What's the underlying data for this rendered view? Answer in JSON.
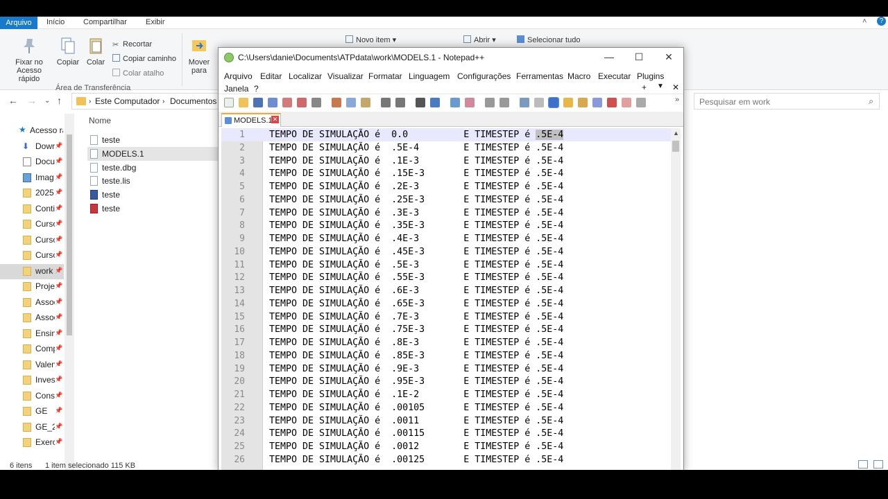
{
  "explorer": {
    "tabs": [
      "Arquivo",
      "Início",
      "Compartilhar",
      "Exibir"
    ],
    "ribbon": {
      "pin_label_1": "Fixar no",
      "pin_label_2": "Acesso rápido",
      "copy": "Copiar",
      "paste": "Colar",
      "cut": "Recortar",
      "copy_path": "Copiar caminho",
      "paste_shortcut": "Colar atalho",
      "move_1": "Mover",
      "move_2": "para",
      "new_item": "Novo item",
      "open": "Abrir",
      "select_all": "Selecionar tudo",
      "clipboard_group": "Área de Transferência"
    },
    "address": {
      "crumb1": "Este Computador",
      "crumb2": "Documentos",
      "search_placeholder": "Pesquisar em work"
    },
    "nav_items": [
      {
        "label": "Acesso rá"
      },
      {
        "label": "Dowr"
      },
      {
        "label": "Docu"
      },
      {
        "label": "Imag"
      },
      {
        "label": "2025"
      },
      {
        "label": "Conti"
      },
      {
        "label": "Curso"
      },
      {
        "label": "Curso"
      },
      {
        "label": "Curso"
      },
      {
        "label": "work"
      },
      {
        "label": "Proje"
      },
      {
        "label": "Assoc"
      },
      {
        "label": "Assoc"
      },
      {
        "label": "Ensin"
      },
      {
        "label": "Comp"
      },
      {
        "label": "Valen"
      },
      {
        "label": "Inves"
      },
      {
        "label": "Cons"
      },
      {
        "label": "GE"
      },
      {
        "label": "GE_2("
      },
      {
        "label": "Exerc"
      }
    ],
    "list_header": "Nome",
    "files": [
      "teste",
      "MODELS.1",
      "teste.dbg",
      "teste.lis",
      "teste",
      "teste"
    ],
    "status": {
      "count": "6 itens",
      "selected": "1 item selecionado  115 KB"
    }
  },
  "npp": {
    "title": "C:\\Users\\danie\\Documents\\ATPdata\\work\\MODELS.1 - Notepad++",
    "menu": [
      "Arquivo",
      "Editar",
      "Localizar",
      "Visualizar",
      "Formatar",
      "Linguagem",
      "Configurações",
      "Ferramentas",
      "Macro",
      "Executar",
      "Plugins",
      "Janela",
      "?"
    ],
    "menu_extra": [
      "+",
      "▼",
      "✕"
    ],
    "tab_label": "MODELS.1",
    "lines": [
      {
        "n": "1",
        "time": "0.0",
        "step": ".5E-4"
      },
      {
        "n": "2",
        "time": ".5E-4",
        "step": ".5E-4"
      },
      {
        "n": "3",
        "time": ".1E-3",
        "step": ".5E-4"
      },
      {
        "n": "4",
        "time": ".15E-3",
        "step": ".5E-4"
      },
      {
        "n": "5",
        "time": ".2E-3",
        "step": ".5E-4"
      },
      {
        "n": "6",
        "time": ".25E-3",
        "step": ".5E-4"
      },
      {
        "n": "7",
        "time": ".3E-3",
        "step": ".5E-4"
      },
      {
        "n": "8",
        "time": ".35E-3",
        "step": ".5E-4"
      },
      {
        "n": "9",
        "time": ".4E-3",
        "step": ".5E-4"
      },
      {
        "n": "10",
        "time": ".45E-3",
        "step": ".5E-4"
      },
      {
        "n": "11",
        "time": ".5E-3",
        "step": ".5E-4"
      },
      {
        "n": "12",
        "time": ".55E-3",
        "step": ".5E-4"
      },
      {
        "n": "13",
        "time": ".6E-3",
        "step": ".5E-4"
      },
      {
        "n": "14",
        "time": ".65E-3",
        "step": ".5E-4"
      },
      {
        "n": "15",
        "time": ".7E-3",
        "step": ".5E-4"
      },
      {
        "n": "16",
        "time": ".75E-3",
        "step": ".5E-4"
      },
      {
        "n": "17",
        "time": ".8E-3",
        "step": ".5E-4"
      },
      {
        "n": "18",
        "time": ".85E-3",
        "step": ".5E-4"
      },
      {
        "n": "19",
        "time": ".9E-3",
        "step": ".5E-4"
      },
      {
        "n": "20",
        "time": ".95E-3",
        "step": ".5E-4"
      },
      {
        "n": "21",
        "time": ".1E-2",
        "step": ".5E-4"
      },
      {
        "n": "22",
        "time": ".00105",
        "step": ".5E-4"
      },
      {
        "n": "23",
        "time": ".0011",
        "step": ".5E-4"
      },
      {
        "n": "24",
        "time": ".00115",
        "step": ".5E-4"
      },
      {
        "n": "25",
        "time": ".0012",
        "step": ".5E-4"
      },
      {
        "n": "26",
        "time": ".00125",
        "step": ".5E-4"
      }
    ],
    "line_prefix": "TEMPO DE SIMULAÇÃO é",
    "line_mid": "E TIMESTEP é"
  }
}
